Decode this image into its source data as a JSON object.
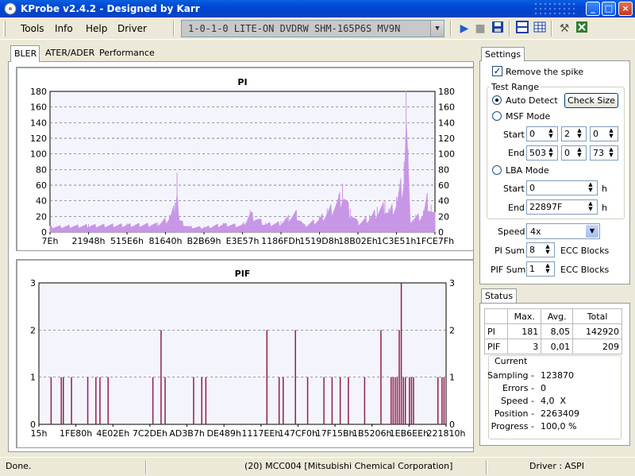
{
  "window": {
    "title": "KProbe v2.4.2 - Designed by Karr"
  },
  "menu": [
    "Tools",
    "Info",
    "Help",
    "Driver"
  ],
  "drive": {
    "selected": "1-0-1-0 LITE-ON DVDRW SHM-165P6S MV9N"
  },
  "toolbar": [
    "play-icon",
    "stop-icon",
    "save-icon",
    "layout-icon",
    "table-icon",
    "tools-icon",
    "exit-icon"
  ],
  "tabs": [
    "BLER",
    "ATER/ADER",
    "Performance"
  ],
  "colors": {
    "pi": "#C896E6",
    "pif": "#8C2050",
    "title_blue": "#0A5FE0"
  },
  "settings": {
    "tab": "Settings",
    "remove_spike": {
      "label": "Remove the spike",
      "checked": true
    },
    "group_title": "Test Range",
    "auto_detect": "Auto Detect",
    "check_size": "Check Size",
    "msf_mode": "MSF Mode",
    "start_label": "Start",
    "end_label": "End",
    "msf_start": [
      "0",
      "2",
      "0"
    ],
    "msf_end": [
      "503",
      "0",
      "73"
    ],
    "lba_mode": "LBA Mode",
    "lba_start": "0",
    "lba_end": "22897F",
    "unit_h": "h",
    "speed_label": "Speed",
    "speed": "4x",
    "pi_sum_label": "PI Sum",
    "pi_sum": "8",
    "pif_sum_label": "PIF Sum",
    "pif_sum": "1",
    "ecc_blocks": "ECC Blocks"
  },
  "status": {
    "tab": "Status",
    "headers": [
      "",
      "Max.",
      "Avg.",
      "Total"
    ],
    "rows": [
      [
        "PI",
        "181",
        "8,05",
        "142920"
      ],
      [
        "PIF",
        "3",
        "0,01",
        "209"
      ]
    ],
    "current_title": "Current",
    "current": [
      {
        "k": "Sampling -",
        "v": "123870"
      },
      {
        "k": "Errors -",
        "v": "0"
      },
      {
        "k": "Speed -",
        "v": "4,0  X"
      },
      {
        "k": "Position -",
        "v": "2263409"
      },
      {
        "k": "Progress -",
        "v": "100,0 %"
      }
    ]
  },
  "statusbar": {
    "left": "Done.",
    "center": "(20) MCC004 [Mitsubishi Chemical Corporation]",
    "right": "Driver : ASPI"
  },
  "chart_data": [
    {
      "type": "area",
      "title": "PI",
      "ylim": [
        0,
        180
      ],
      "yticks": [
        0,
        20,
        40,
        60,
        80,
        100,
        120,
        140,
        160,
        180
      ],
      "xticks": [
        "7Eh",
        "21948h",
        "515E6h",
        "81640h",
        "B2B69h",
        "E3E57h",
        "1186FDh",
        "1519D8h",
        "18B02Eh",
        "1C3E51h",
        "1FCE7Fh"
      ],
      "peaks": [
        {
          "x": 0.0,
          "v": 8
        },
        {
          "x": 0.05,
          "v": 9
        },
        {
          "x": 0.1,
          "v": 10
        },
        {
          "x": 0.2,
          "v": 11
        },
        {
          "x": 0.28,
          "v": 12
        },
        {
          "x": 0.31,
          "v": 22
        },
        {
          "x": 0.325,
          "v": 38
        },
        {
          "x": 0.33,
          "v": 76
        },
        {
          "x": 0.335,
          "v": 18
        },
        {
          "x": 0.36,
          "v": 8
        },
        {
          "x": 0.4,
          "v": 7
        },
        {
          "x": 0.45,
          "v": 12
        },
        {
          "x": 0.5,
          "v": 10
        },
        {
          "x": 0.52,
          "v": 28
        },
        {
          "x": 0.56,
          "v": 12
        },
        {
          "x": 0.6,
          "v": 14
        },
        {
          "x": 0.62,
          "v": 22
        },
        {
          "x": 0.64,
          "v": 28
        },
        {
          "x": 0.66,
          "v": 10
        },
        {
          "x": 0.7,
          "v": 20
        },
        {
          "x": 0.72,
          "v": 30
        },
        {
          "x": 0.75,
          "v": 48
        },
        {
          "x": 0.76,
          "v": 62
        },
        {
          "x": 0.78,
          "v": 30
        },
        {
          "x": 0.8,
          "v": 14
        },
        {
          "x": 0.83,
          "v": 22
        },
        {
          "x": 0.85,
          "v": 32
        },
        {
          "x": 0.87,
          "v": 40
        },
        {
          "x": 0.88,
          "v": 30
        },
        {
          "x": 0.9,
          "v": 45
        },
        {
          "x": 0.91,
          "v": 66
        },
        {
          "x": 0.92,
          "v": 90
        },
        {
          "x": 0.925,
          "v": 181
        },
        {
          "x": 0.93,
          "v": 105
        },
        {
          "x": 0.935,
          "v": 20
        },
        {
          "x": 0.95,
          "v": 22
        },
        {
          "x": 0.97,
          "v": 28
        },
        {
          "x": 0.98,
          "v": 50
        },
        {
          "x": 0.99,
          "v": 35
        },
        {
          "x": 1.0,
          "v": 25
        }
      ]
    },
    {
      "type": "bar",
      "title": "PIF",
      "ylim": [
        0,
        3
      ],
      "yticks": [
        0,
        1,
        2,
        3
      ],
      "xticks": [
        "15h",
        "1FE80h",
        "4E02Eh",
        "7C2DEh",
        "AD3B7h",
        "DE489h",
        "1117EEh",
        "147CF0h",
        "17F15Bh",
        "1B5206h",
        "1EB6EEh",
        "221810h"
      ],
      "bars": [
        {
          "x": 0.03,
          "v": 1
        },
        {
          "x": 0.055,
          "v": 1
        },
        {
          "x": 0.06,
          "v": 1
        },
        {
          "x": 0.08,
          "v": 1
        },
        {
          "x": 0.12,
          "v": 1
        },
        {
          "x": 0.14,
          "v": 1
        },
        {
          "x": 0.15,
          "v": 1
        },
        {
          "x": 0.17,
          "v": 1
        },
        {
          "x": 0.28,
          "v": 1
        },
        {
          "x": 0.3,
          "v": 2
        },
        {
          "x": 0.31,
          "v": 1
        },
        {
          "x": 0.38,
          "v": 1
        },
        {
          "x": 0.4,
          "v": 1
        },
        {
          "x": 0.41,
          "v": 1
        },
        {
          "x": 0.56,
          "v": 2
        },
        {
          "x": 0.59,
          "v": 1
        },
        {
          "x": 0.6,
          "v": 1
        },
        {
          "x": 0.63,
          "v": 2
        },
        {
          "x": 0.66,
          "v": 1
        },
        {
          "x": 0.7,
          "v": 1
        },
        {
          "x": 0.72,
          "v": 1
        },
        {
          "x": 0.74,
          "v": 1
        },
        {
          "x": 0.76,
          "v": 1
        },
        {
          "x": 0.8,
          "v": 1
        },
        {
          "x": 0.84,
          "v": 2
        },
        {
          "x": 0.865,
          "v": 1
        },
        {
          "x": 0.87,
          "v": 1
        },
        {
          "x": 0.875,
          "v": 1
        },
        {
          "x": 0.88,
          "v": 1
        },
        {
          "x": 0.885,
          "v": 2
        },
        {
          "x": 0.89,
          "v": 3
        },
        {
          "x": 0.895,
          "v": 1
        },
        {
          "x": 0.9,
          "v": 1
        },
        {
          "x": 0.91,
          "v": 1
        },
        {
          "x": 0.915,
          "v": 1
        },
        {
          "x": 0.92,
          "v": 1
        },
        {
          "x": 0.98,
          "v": 1
        },
        {
          "x": 0.99,
          "v": 1
        },
        {
          "x": 0.995,
          "v": 1
        }
      ]
    }
  ]
}
